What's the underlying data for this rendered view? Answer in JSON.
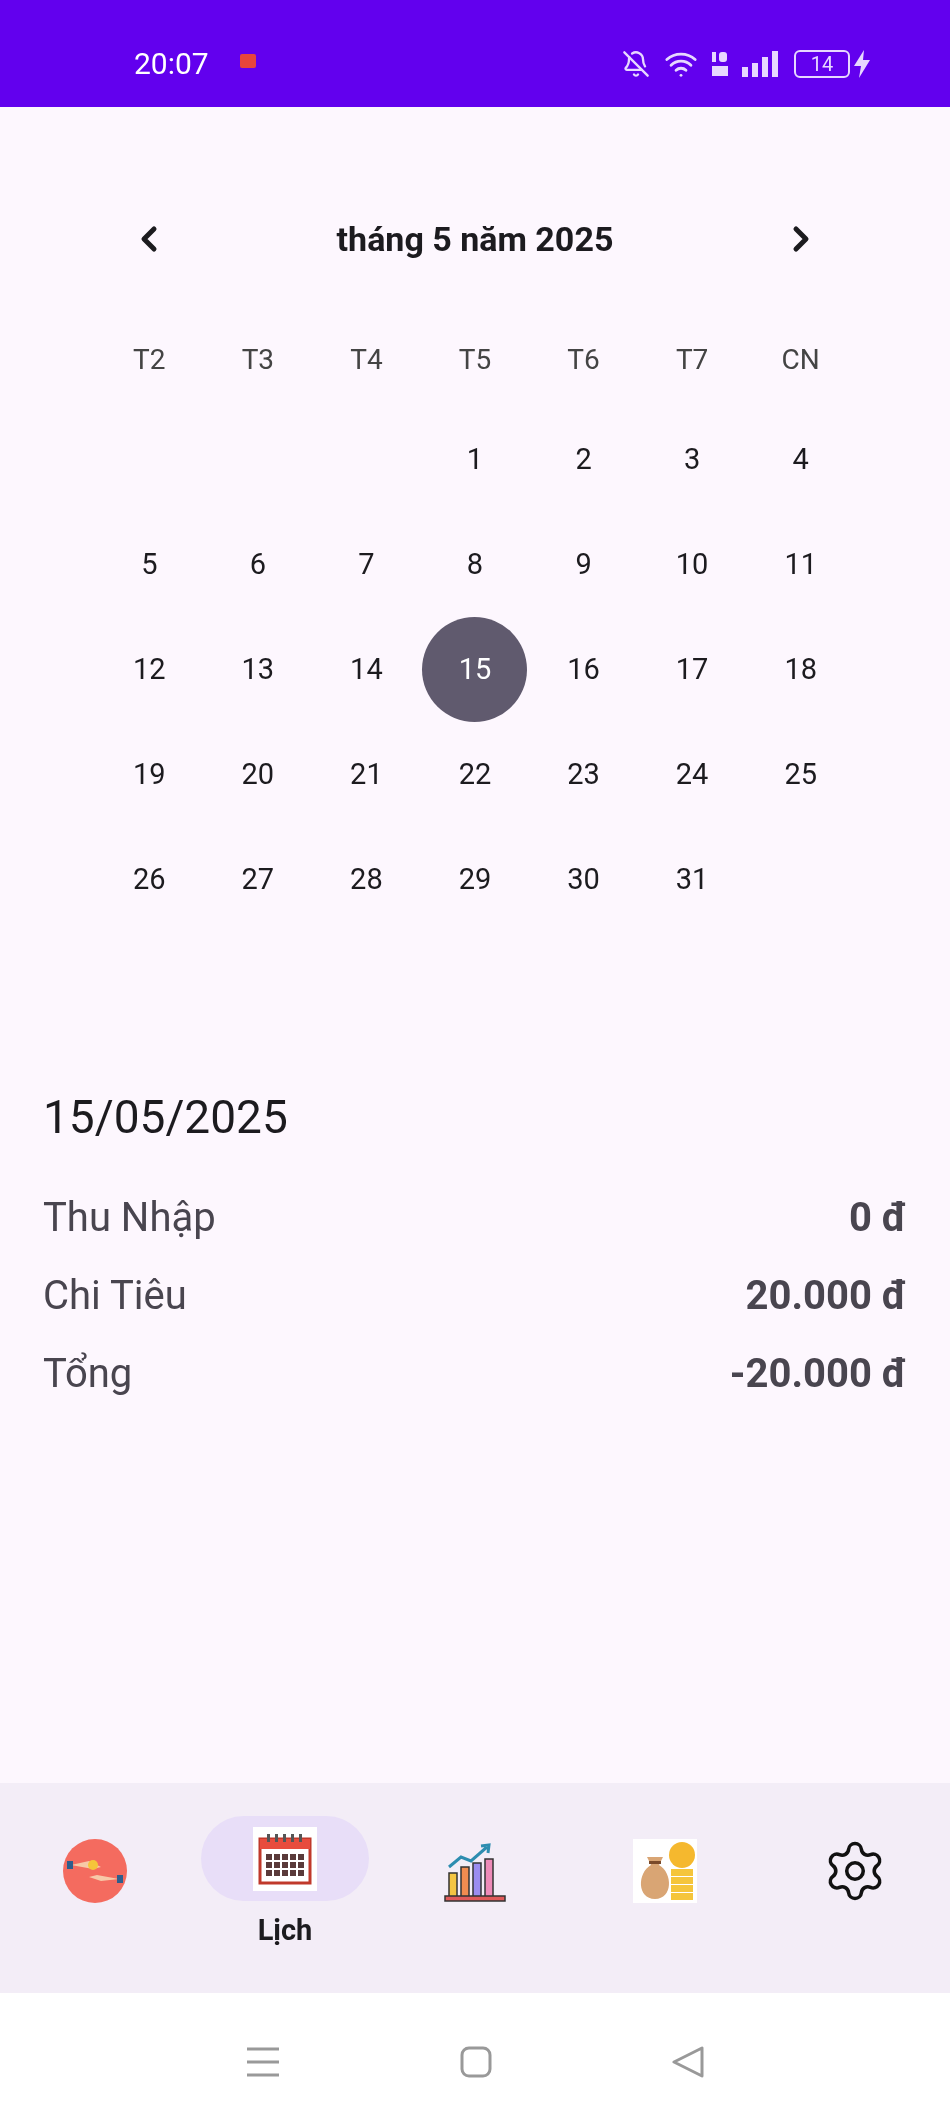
{
  "status_bar": {
    "time": "20:07",
    "battery": "14"
  },
  "calendar": {
    "title": "tháng 5 năm 2025",
    "weekdays": [
      "T2",
      "T3",
      "T4",
      "T5",
      "T6",
      "T7",
      "CN"
    ],
    "weeks": [
      {
        "kind": "first",
        "days": [
          {
            "day": "1",
            "selected": false
          },
          {
            "day": "2",
            "selected": false
          },
          {
            "day": "3",
            "selected": false
          },
          {
            "day": "4",
            "selected": false
          }
        ]
      },
      {
        "kind": "week",
        "days": [
          {
            "day": "5",
            "selected": false
          },
          {
            "day": "6",
            "selected": false
          },
          {
            "day": "7",
            "selected": false
          },
          {
            "day": "8",
            "selected": false
          },
          {
            "day": "9",
            "selected": false
          },
          {
            "day": "10",
            "selected": false
          },
          {
            "day": "11",
            "selected": false
          }
        ]
      },
      {
        "kind": "week",
        "days": [
          {
            "day": "12",
            "selected": false
          },
          {
            "day": "13",
            "selected": false
          },
          {
            "day": "14",
            "selected": false
          },
          {
            "day": "15",
            "selected": true
          },
          {
            "day": "16",
            "selected": false
          },
          {
            "day": "17",
            "selected": false
          },
          {
            "day": "18",
            "selected": false
          }
        ]
      },
      {
        "kind": "week",
        "days": [
          {
            "day": "19",
            "selected": false
          },
          {
            "day": "20",
            "selected": false
          },
          {
            "day": "21",
            "selected": false
          },
          {
            "day": "22",
            "selected": false
          },
          {
            "day": "23",
            "selected": false
          },
          {
            "day": "24",
            "selected": false
          },
          {
            "day": "25",
            "selected": false
          }
        ]
      },
      {
        "kind": "week",
        "days": [
          {
            "day": "26",
            "selected": false
          },
          {
            "day": "27",
            "selected": false
          },
          {
            "day": "28",
            "selected": false
          },
          {
            "day": "29",
            "selected": false
          },
          {
            "day": "30",
            "selected": false
          },
          {
            "day": "31",
            "selected": false
          }
        ]
      }
    ]
  },
  "summary": {
    "date": "15/05/2025",
    "rows": [
      {
        "label": "Thu Nhập",
        "value": "0 đ"
      },
      {
        "label": "Chi Tiêu",
        "value": "20.000 đ"
      },
      {
        "label": "Tổng",
        "value": "-20.000 đ"
      }
    ]
  },
  "bottom_nav": [
    {
      "kind": "exchange",
      "selected": false
    },
    {
      "kind": "calendar",
      "selected": true,
      "label": "Lịch"
    },
    {
      "kind": "chart",
      "selected": false
    },
    {
      "kind": "money",
      "selected": false
    },
    {
      "kind": "settings",
      "selected": false
    }
  ]
}
